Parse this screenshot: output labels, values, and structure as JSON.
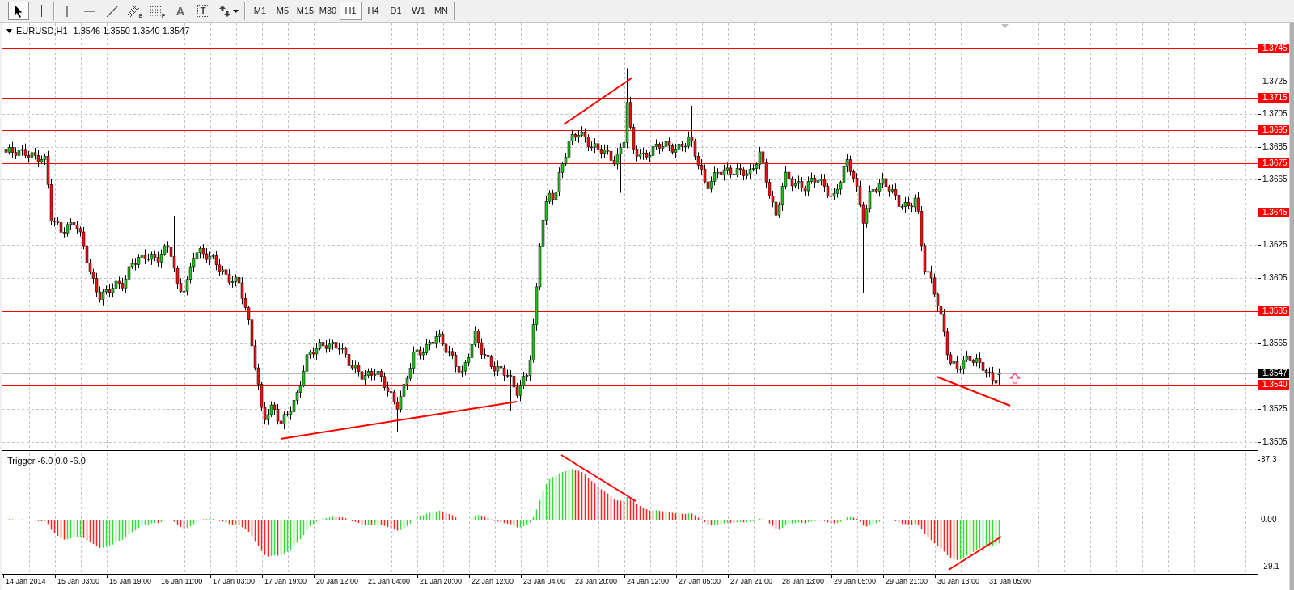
{
  "toolbar": {
    "tools": [
      {
        "kind": "cursor",
        "selected": true
      },
      {
        "kind": "crosshair",
        "selected": false
      },
      {
        "kind": "vertical-line",
        "selected": false
      },
      {
        "kind": "horizontal-line",
        "selected": false
      },
      {
        "kind": "trend-line",
        "selected": false
      },
      {
        "kind": "channel",
        "glyph": "E",
        "selected": false
      },
      {
        "kind": "fibo",
        "glyph": "F",
        "selected": false
      },
      {
        "kind": "text",
        "glyph": "A",
        "selected": false
      },
      {
        "kind": "label",
        "glyph": "T",
        "selected": false
      },
      {
        "kind": "arrows",
        "selected": false
      }
    ],
    "timeframes": [
      {
        "label": "M1",
        "selected": false
      },
      {
        "label": "M5",
        "selected": false
      },
      {
        "label": "M15",
        "selected": false
      },
      {
        "label": "M30",
        "selected": false
      },
      {
        "label": "H1",
        "selected": true
      },
      {
        "label": "H4",
        "selected": false
      },
      {
        "label": "D1",
        "selected": false
      },
      {
        "label": "W1",
        "selected": false
      },
      {
        "label": "MN",
        "selected": false
      }
    ]
  },
  "chart": {
    "title": "EURUSD,H1",
    "quote": "1.3546 1.3550 1.3540 1.3547",
    "price_axis": [
      "1.3725",
      "1.3705",
      "1.3685",
      "1.3665",
      "1.3625",
      "1.3605",
      "1.3565",
      "1.3525",
      "1.3505"
    ],
    "levels": [
      "1.3745",
      "1.3715",
      "1.3695",
      "1.3675",
      "1.3645",
      "1.3585",
      "1.3540"
    ],
    "current_price": "1.3547"
  },
  "indicator": {
    "title": "Trigger -6.0 0.0 -6.0",
    "axis": [
      "37.3",
      "0.00",
      "-29.1"
    ]
  },
  "time_axis": [
    "14 Jan 2014",
    "15 Jan 03:00",
    "15 Jan 19:00",
    "16 Jan 11:00",
    "17 Jan 03:00",
    "17 Jan 19:00",
    "20 Jan 12:00",
    "21 Jan 04:00",
    "21 Jan 20:00",
    "22 Jan 12:00",
    "23 Jan 04:00",
    "23 Jan 20:00",
    "24 Jan 12:00",
    "27 Jan 05:00",
    "27 Jan 21:00",
    "28 Jan 13:00",
    "29 Jan 05:00",
    "29 Jan 21:00",
    "30 Jan 13:00",
    "31 Jan 05:00"
  ]
}
